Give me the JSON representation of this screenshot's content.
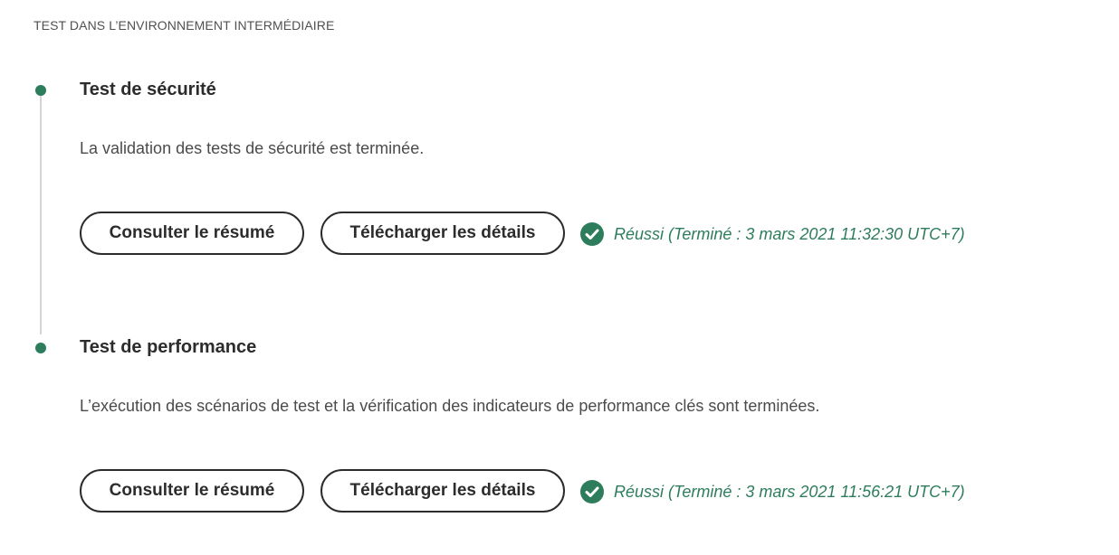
{
  "section": {
    "heading": "TEST DANS L’ENVIRONNEMENT INTERMÉDIAIRE"
  },
  "steps": [
    {
      "title": "Test de sécurité",
      "description": "La validation des tests de sécurité est terminée.",
      "summary_button": "Consulter le résumé",
      "download_button": "Télécharger les détails",
      "status_icon": "check-circle-icon",
      "status_text": "Réussi (Terminé : 3 mars 2021 11:32:30 UTC+7)"
    },
    {
      "title": "Test de performance",
      "description": "L’exécution des scénarios de test et la vérification des indicateurs de performance clés sont terminées.",
      "summary_button": "Consulter le résumé",
      "download_button": "Télécharger les détails",
      "status_icon": "check-circle-icon",
      "status_text": "Réussi (Terminé : 3 mars 2021 11:56:21 UTC+7)"
    }
  ],
  "colors": {
    "success": "#2d7d5d",
    "timeline_line": "#d5d5d5",
    "text_primary": "#2c2c2c"
  }
}
